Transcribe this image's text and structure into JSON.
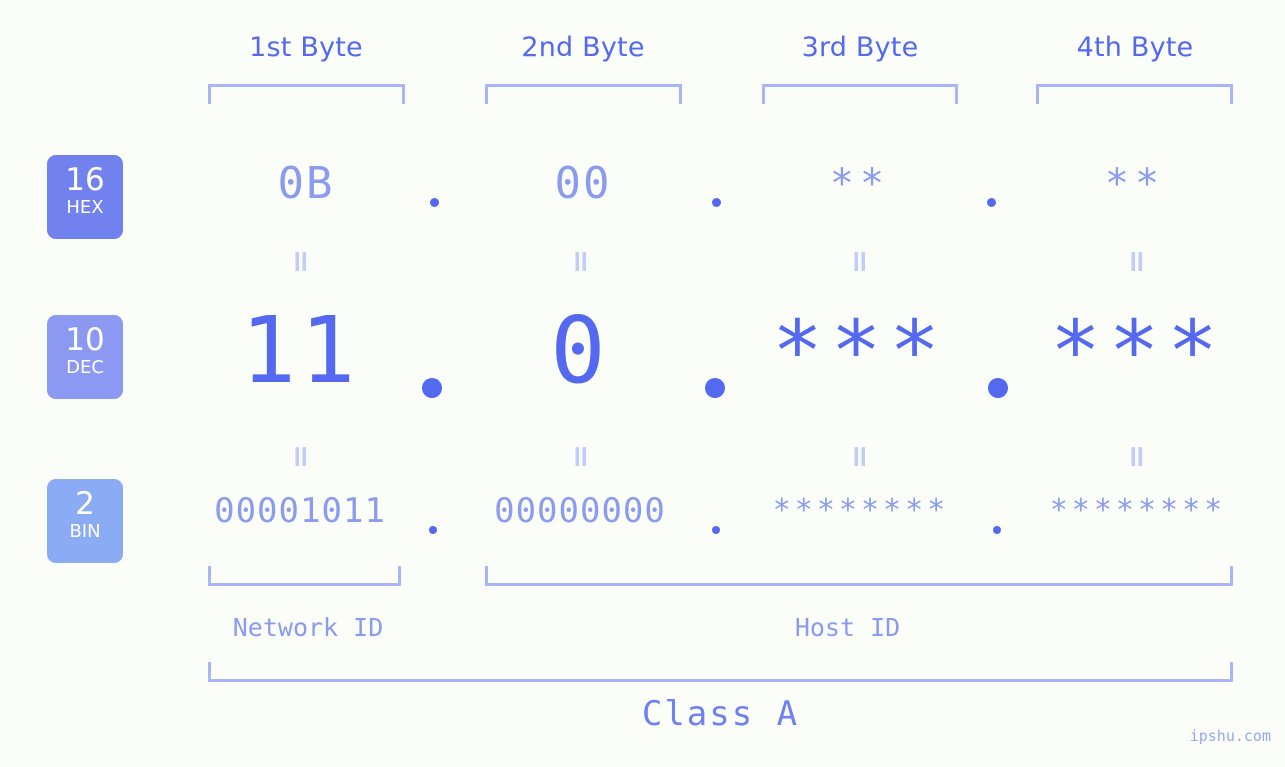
{
  "meta": {
    "background_color": "#fbfdf8",
    "accent_strong": "#5468f0",
    "accent_light": "#8a9bf0",
    "accent_pale": "#aab5f7",
    "watermark": "ipshu.com"
  },
  "byte_headers": [
    {
      "label": "1st Byte"
    },
    {
      "label": "2nd Byte"
    },
    {
      "label": "3rd Byte"
    },
    {
      "label": "4th Byte"
    }
  ],
  "bases": [
    {
      "num": "16",
      "label": "HEX",
      "color": "#7182ef"
    },
    {
      "num": "10",
      "label": "DEC",
      "color": "#8b99f2"
    },
    {
      "num": "2",
      "label": "BIN",
      "color": "#8cabf5"
    }
  ],
  "rows": {
    "hex": {
      "values": [
        "0B",
        "00",
        "**",
        "**"
      ],
      "separator": "."
    },
    "dec": {
      "values": [
        "11",
        "0",
        "***",
        "***"
      ],
      "separator": "."
    },
    "bin": {
      "values": [
        "00001011",
        "00000000",
        "********",
        "********"
      ],
      "separator": "."
    }
  },
  "equals_symbol": "=",
  "sections": [
    {
      "label": "Network ID"
    },
    {
      "label": "Host ID"
    }
  ],
  "class": {
    "label": "Class A"
  }
}
